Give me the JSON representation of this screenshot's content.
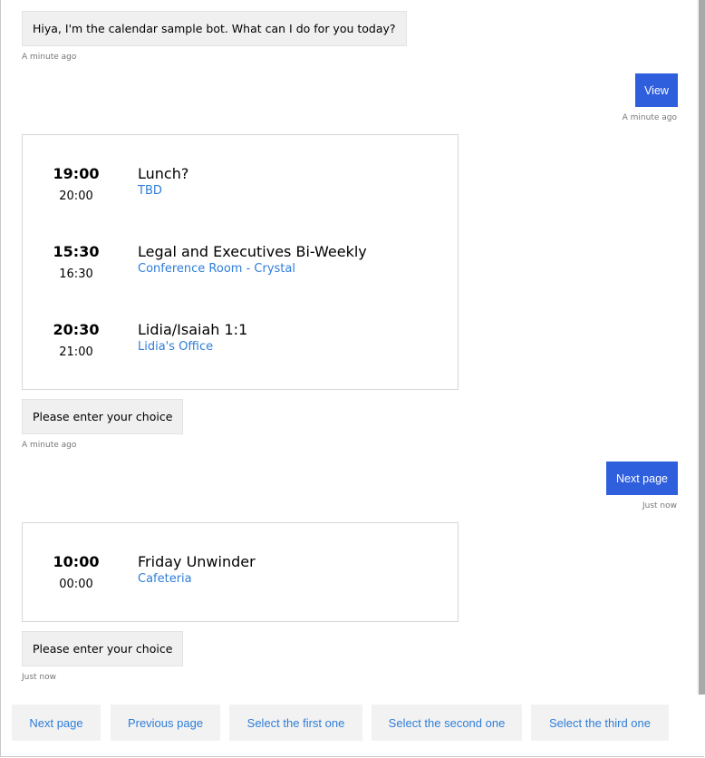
{
  "transcript": {
    "greeting": {
      "text": "Hiya, I'm the calendar sample bot. What can I do for you today?",
      "timestamp": "A minute ago"
    },
    "user_view": {
      "text": "View",
      "timestamp": "A minute ago"
    },
    "card1": {
      "events": [
        {
          "start": "19:00",
          "end": "20:00",
          "title": "Lunch?",
          "location": "TBD"
        },
        {
          "start": "15:30",
          "end": "16:30",
          "title": "Legal and Executives Bi-Weekly",
          "location": "Conference Room - Crystal"
        },
        {
          "start": "20:30",
          "end": "21:00",
          "title": "Lidia/Isaiah 1:1",
          "location": "Lidia's Office"
        }
      ]
    },
    "prompt1": {
      "text": "Please enter your choice",
      "timestamp": "A minute ago"
    },
    "user_next": {
      "text": "Next page",
      "timestamp": "Just now"
    },
    "card2": {
      "events": [
        {
          "start": "10:00",
          "end": "00:00",
          "title": "Friday Unwinder",
          "location": "Cafeteria"
        }
      ]
    },
    "prompt2": {
      "text": "Please enter your choice",
      "timestamp": "Just now"
    }
  },
  "suggested_actions": [
    "Next page",
    "Previous page",
    "Select the first one",
    "Select the second one",
    "Select the third one"
  ],
  "colors": {
    "user_bubble": "#2f5fdc",
    "link": "#2f7ed8",
    "bot_bubble": "#f0f0f0",
    "timestamp": "#767676"
  }
}
